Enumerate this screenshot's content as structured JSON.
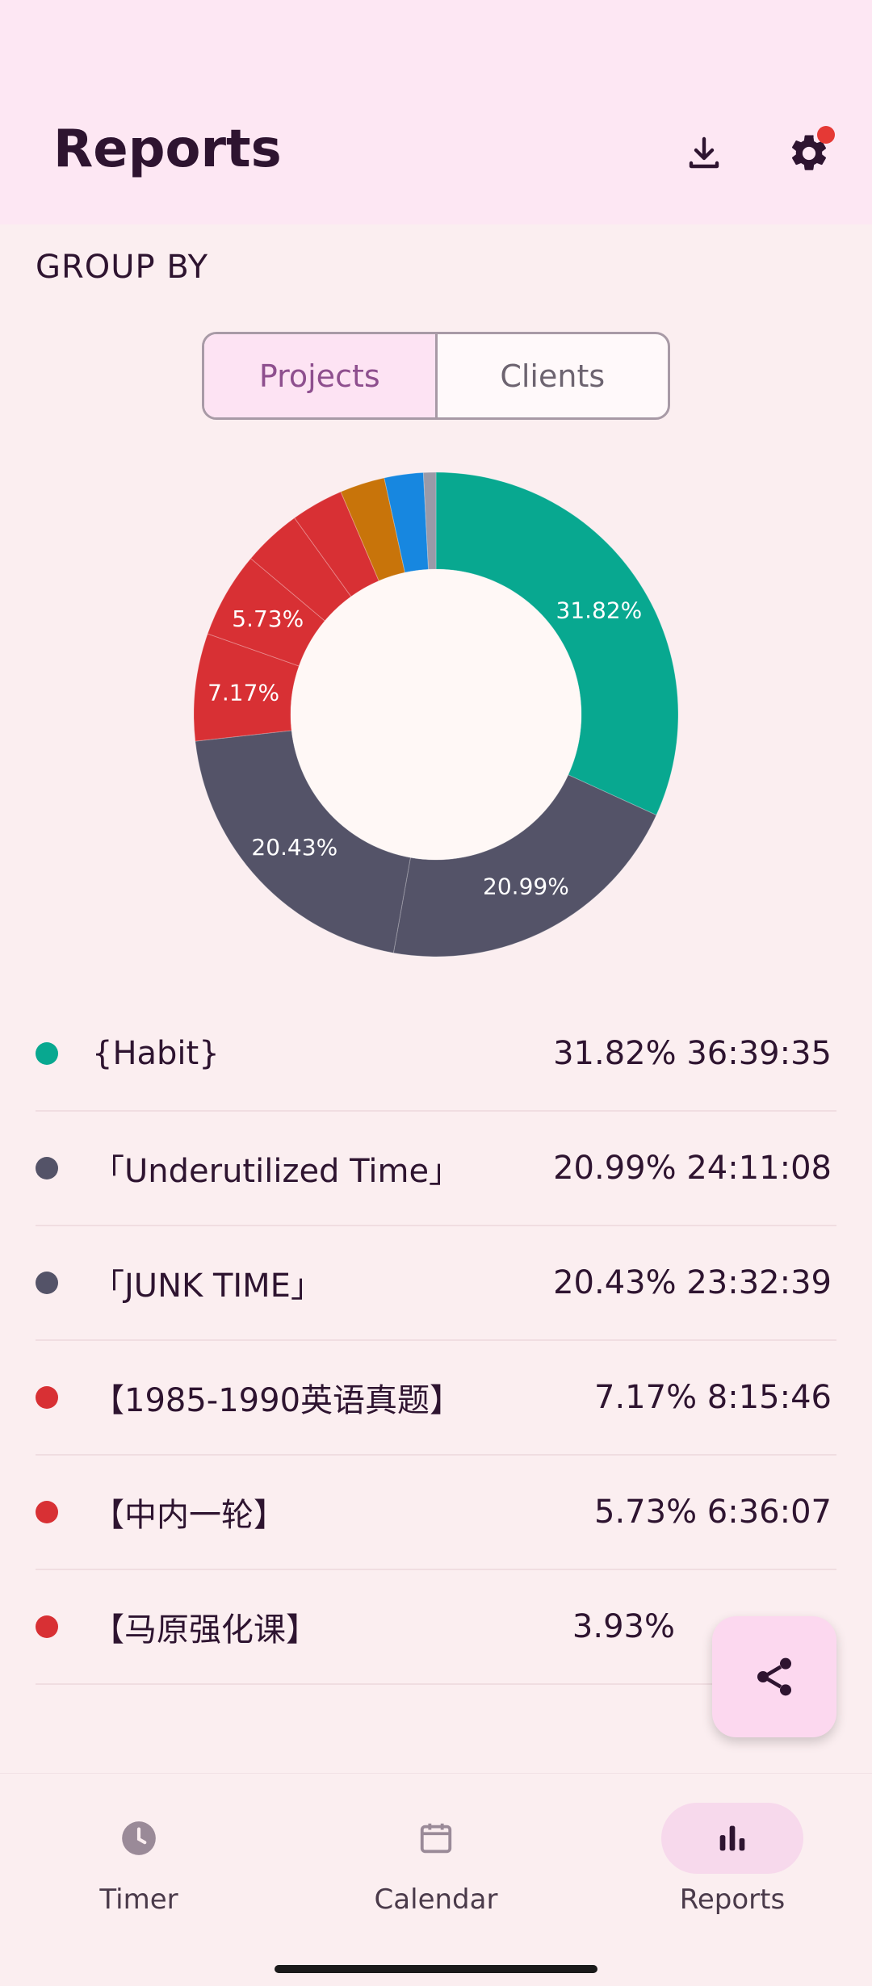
{
  "header": {
    "title": "Reports",
    "download_icon": "download-icon",
    "settings_icon": "gear-icon",
    "badge_color": "#e53935"
  },
  "group_by": {
    "label": "GROUP BY",
    "options": [
      {
        "label": "Projects",
        "selected": true
      },
      {
        "label": "Clients",
        "selected": false
      }
    ]
  },
  "chart_data": {
    "type": "pie",
    "donut": true,
    "slices": [
      {
        "name": "{Habit}",
        "percent": 31.82,
        "label": "31.82%",
        "color": "#08a890"
      },
      {
        "name": "「Underutilized Time」",
        "percent": 20.99,
        "label": "20.99%",
        "color": "#545368"
      },
      {
        "name": "「JUNK TIME」",
        "percent": 20.43,
        "label": "20.43%",
        "color": "#545368"
      },
      {
        "name": "【1985-1990英语真题】",
        "percent": 7.17,
        "label": "7.17%",
        "color": "#d83034"
      },
      {
        "name": "【中内一轮】",
        "percent": 5.73,
        "label": "5.73%",
        "color": "#d83034"
      },
      {
        "name": "【马原强化课】",
        "percent": 3.93,
        "label": "",
        "color": "#d83034"
      },
      {
        "name": "",
        "percent": 3.5,
        "label": "",
        "color": "#d83034"
      },
      {
        "name": "",
        "percent": 3.0,
        "label": "",
        "color": "#c8740a"
      },
      {
        "name": "",
        "percent": 2.6,
        "label": "",
        "color": "#1787e0"
      },
      {
        "name": "",
        "percent": 0.83,
        "label": "",
        "color": "#9a9aa8"
      }
    ]
  },
  "list": [
    {
      "name": "{Habit}",
      "percent": "31.82%",
      "duration": "36:39:35",
      "color": "#08a890"
    },
    {
      "name": "「Underutilized Time」",
      "percent": "20.99%",
      "duration": "24:11:08",
      "color": "#545368"
    },
    {
      "name": "「JUNK TIME」",
      "percent": "20.43%",
      "duration": "23:32:39",
      "color": "#545368"
    },
    {
      "name": "【1985-1990英语真题】",
      "percent": "7.17%",
      "duration": "8:15:46",
      "color": "#d83034"
    },
    {
      "name": "【中内一轮】",
      "percent": "5.73%",
      "duration": "6:36:07",
      "color": "#d83034"
    },
    {
      "name": "【马原强化课】",
      "percent": "3.93%",
      "duration": "",
      "color": "#d83034"
    }
  ],
  "fab": {
    "icon": "share-icon"
  },
  "nav": [
    {
      "label": "Timer",
      "icon": "clock-icon",
      "active": false
    },
    {
      "label": "Calendar",
      "icon": "calendar-icon",
      "active": false
    },
    {
      "label": "Reports",
      "icon": "bar-chart-icon",
      "active": true
    }
  ]
}
